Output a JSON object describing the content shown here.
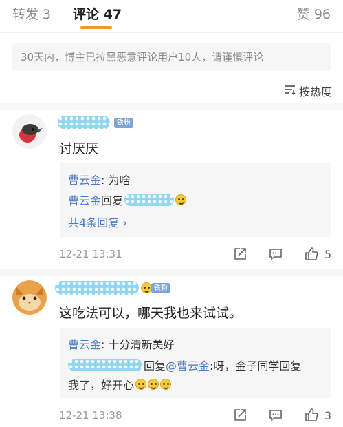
{
  "tabs": {
    "repost": "转发 3",
    "comments": "评论 47",
    "likes": "赞 96"
  },
  "notice": "30天内，博主已拉黑恶意评论用户10人，请谨慎评论",
  "sort": {
    "label": "按热度"
  },
  "comments": [
    {
      "badge": "铁粉",
      "text": "讨厌厌",
      "replies": [
        {
          "user": "曹云金",
          "text": ": 为啥"
        },
        {
          "user": "曹云金",
          "text": "回复"
        }
      ],
      "more": "共4条回复 ›",
      "time": "12-21 13:31",
      "likes": "5"
    },
    {
      "badge": "铁粉",
      "text": "这吃法可以，哪天我也来试试。",
      "replies": [
        {
          "user": "曹云金",
          "text": ": 十分清新美好"
        },
        {
          "prefix": "回复",
          "user": "@曹云金",
          "text": ":呀，金子同学回复"
        }
      ],
      "reply_continuation": "我了，好开心",
      "time": "12-21 13:38",
      "likes": "3"
    }
  ],
  "colors": {
    "accent": "#f39a1d",
    "link": "#4a7bbf",
    "badge": "#7ea3d8"
  }
}
